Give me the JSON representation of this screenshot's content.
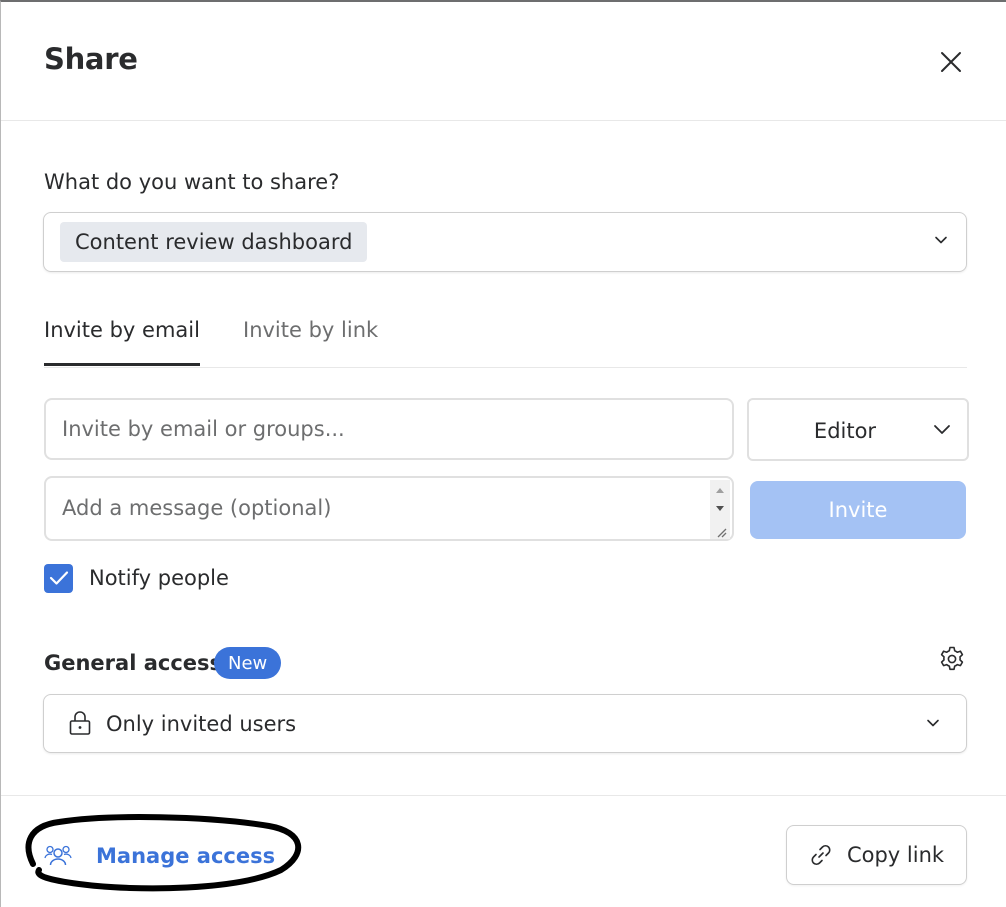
{
  "dialog": {
    "title": "Share"
  },
  "share_target": {
    "question": "What do you want to share?",
    "selected_item": "Content review dashboard"
  },
  "tabs": [
    {
      "label": "Invite by email",
      "active": true
    },
    {
      "label": "Invite by link",
      "active": false
    }
  ],
  "invite": {
    "email_placeholder": "Invite by email or groups...",
    "email_value": "",
    "role": "Editor",
    "message_placeholder": "Add a message (optional)",
    "message_value": "",
    "invite_button": "Invite",
    "invite_button_disabled": true
  },
  "notify": {
    "label": "Notify people",
    "checked": true
  },
  "general_access": {
    "label": "General access",
    "badge": "New",
    "selected": "Only invited users"
  },
  "footer": {
    "manage_access": "Manage access",
    "copy_link": "Copy link"
  },
  "colors": {
    "accent": "#3b73d9",
    "invite_disabled": "#a4c2f4",
    "text": "#2a2b2d",
    "muted": "#6d6e6f"
  },
  "icons": [
    "close-icon",
    "chevron-down-icon",
    "gear-icon",
    "lock-icon",
    "people-icon",
    "link-icon",
    "checkmark-icon"
  ]
}
